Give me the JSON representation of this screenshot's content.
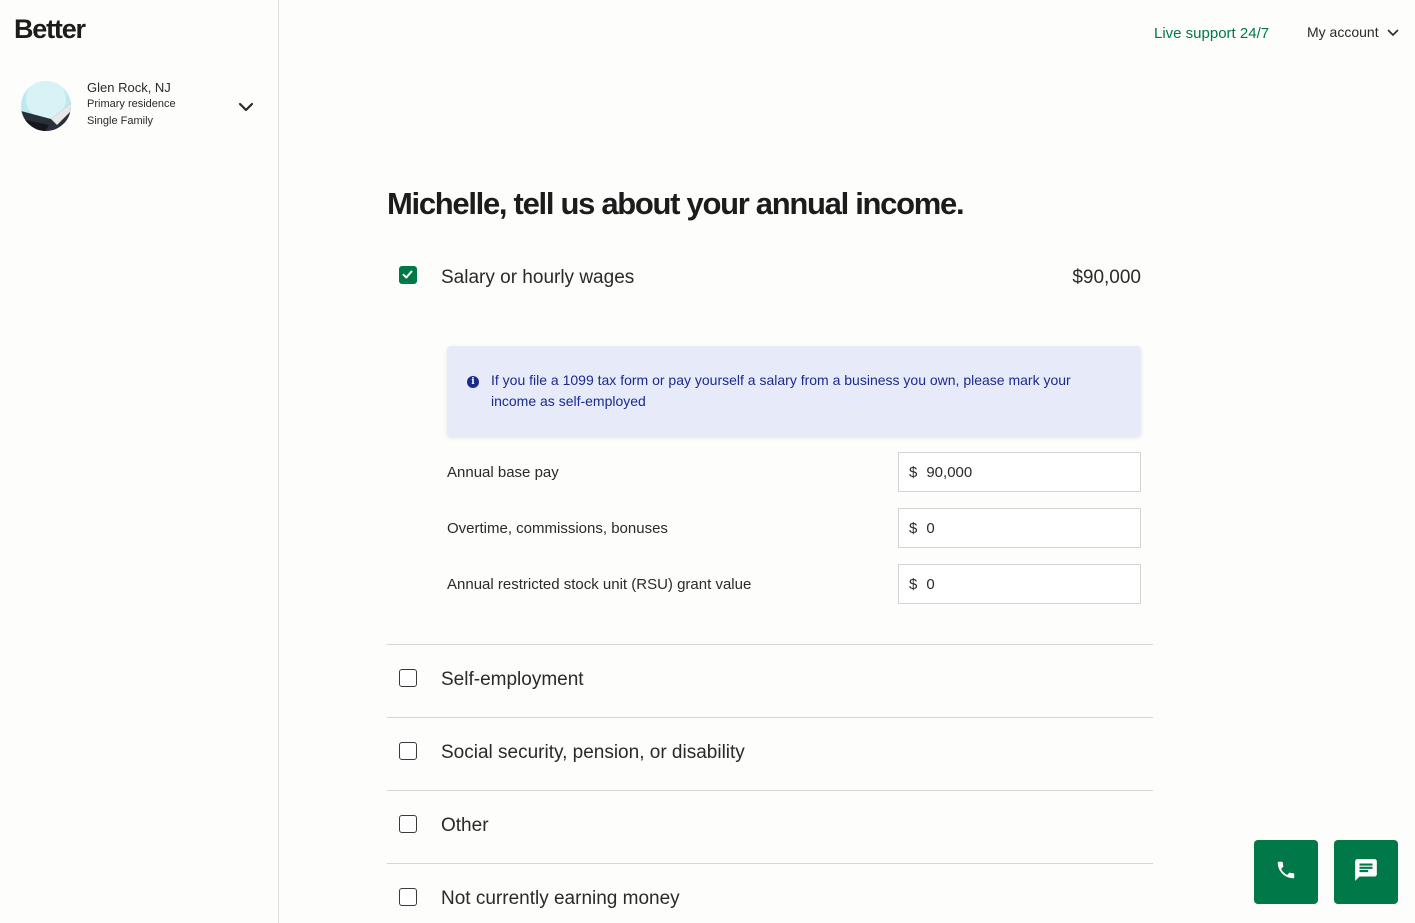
{
  "brand": {
    "logo": "Better"
  },
  "property": {
    "location": "Glen Rock, NJ",
    "occupancy": "Primary residence",
    "type": "Single Family"
  },
  "topbar": {
    "live_support": "Live support 24/7",
    "my_account": "My account"
  },
  "page": {
    "title": "Michelle, tell us about your annual income."
  },
  "income": {
    "salary": {
      "label": "Salary or hourly wages",
      "amount": "$90,000",
      "checked": true,
      "info": "If you file a 1099 tax form or pay yourself a salary from a business you own, please mark your income as self-employed",
      "fields": [
        {
          "label": "Annual base pay",
          "currency": "$",
          "value": "90,000"
        },
        {
          "label": "Overtime, commissions, bonuses",
          "currency": "$",
          "value": "0"
        },
        {
          "label": "Annual restricted stock unit (RSU) grant value",
          "currency": "$",
          "value": "0"
        }
      ]
    },
    "options": [
      {
        "label": "Self-employment",
        "checked": false
      },
      {
        "label": "Social security, pension, or disability",
        "checked": false
      },
      {
        "label": "Other",
        "checked": false
      },
      {
        "label": "Not currently earning money",
        "checked": false
      }
    ]
  },
  "colors": {
    "accent": "#017848",
    "info_bg": "#e6eaf9",
    "info_text": "#1b2a8f"
  },
  "icons": {
    "phone": "phone-icon",
    "chat": "chat-icon",
    "chevron": "chevron-down-icon",
    "info": "info-icon"
  }
}
